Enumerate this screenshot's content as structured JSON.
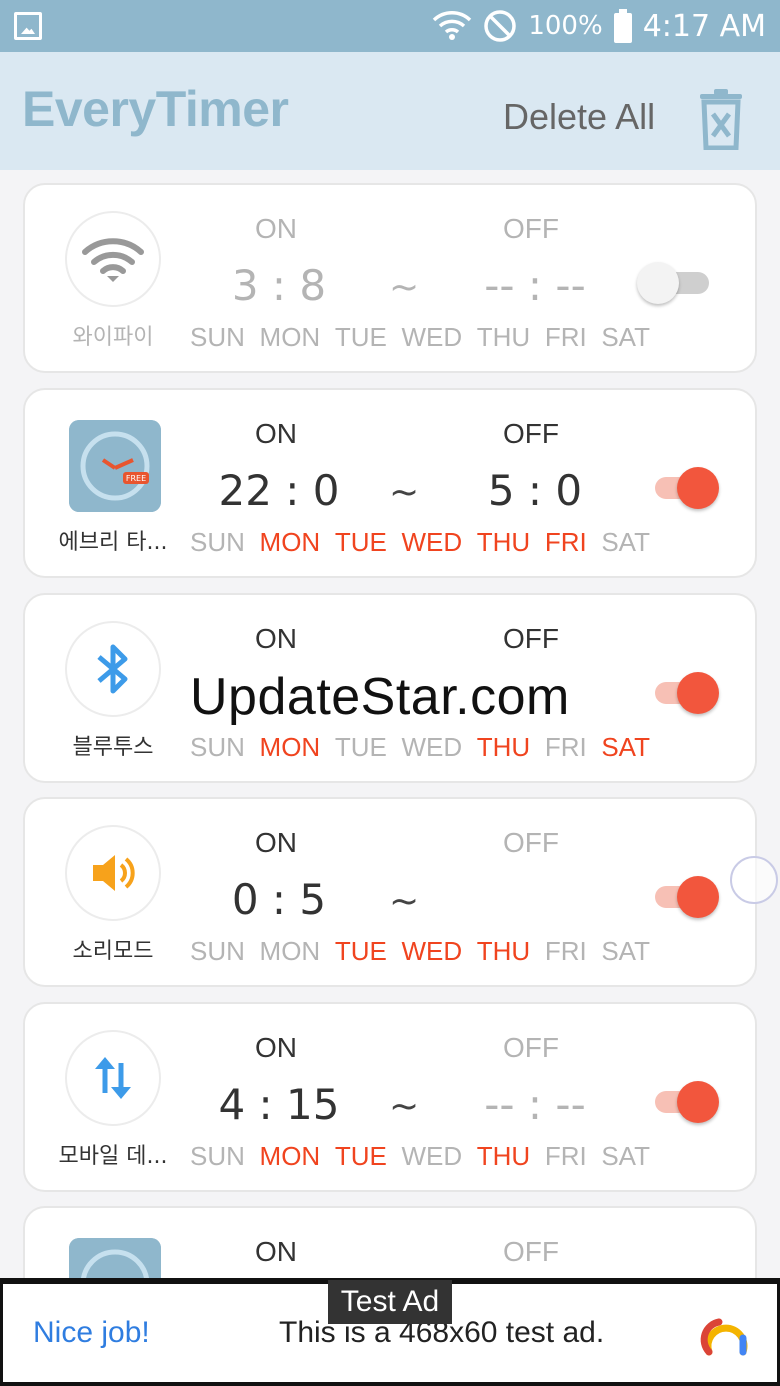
{
  "status_bar": {
    "battery": "100%",
    "time": "4:17 AM",
    "icons": [
      "gallery-icon",
      "wifi-icon",
      "do-not-disturb-icon",
      "battery-icon"
    ]
  },
  "app_bar": {
    "title": "EveryTimer",
    "delete_all_label": "Delete All",
    "delete_icon": "trash-icon"
  },
  "labels": {
    "on": "ON",
    "off": "OFF",
    "tilde": "~"
  },
  "days": [
    "SUN",
    "MON",
    "TUE",
    "WED",
    "THU",
    "FRI",
    "SAT"
  ],
  "timers": [
    {
      "name": "와이파이",
      "icon": "wifi-icon",
      "on_time": "3 : 8",
      "off_time": "-- : --",
      "enabled": false,
      "active_days": []
    },
    {
      "name": "에브리 타...",
      "icon": "everytimer-app-icon",
      "on_time": "22 : 0",
      "off_time": "5 : 0",
      "enabled": true,
      "active_days": [
        1,
        2,
        3,
        4,
        5
      ]
    },
    {
      "name": "블루투스",
      "icon": "bluetooth-icon",
      "on_time": "",
      "off_time": "",
      "enabled": true,
      "active_days": [
        1,
        4,
        6
      ]
    },
    {
      "name": "소리모드",
      "icon": "speaker-icon",
      "on_time": "0 : 5",
      "off_time": "",
      "enabled": true,
      "active_days": [
        2,
        3,
        4
      ]
    },
    {
      "name": "모바일 데...",
      "icon": "mobile-data-icon",
      "on_time": "4 : 15",
      "off_time": "-- : --",
      "enabled": true,
      "active_days": [
        1,
        2,
        4
      ]
    },
    {
      "name": "",
      "icon": "everytimer-app-icon",
      "on_time": "",
      "off_time": "",
      "enabled": true,
      "active_days": []
    }
  ],
  "watermark": "UpdateStar.com",
  "ad": {
    "badge": "Test Ad",
    "nice": "Nice job!",
    "text": "This is a 468x60 test ad.",
    "logo_icon": "ad-logo-icon"
  },
  "colors": {
    "status_bar": "#8fb7cc",
    "app_bar": "#dae8f2",
    "accent": "#f2563d",
    "active_day": "#f0441f",
    "inactive": "#b4b4b4",
    "link": "#2f7de0"
  }
}
